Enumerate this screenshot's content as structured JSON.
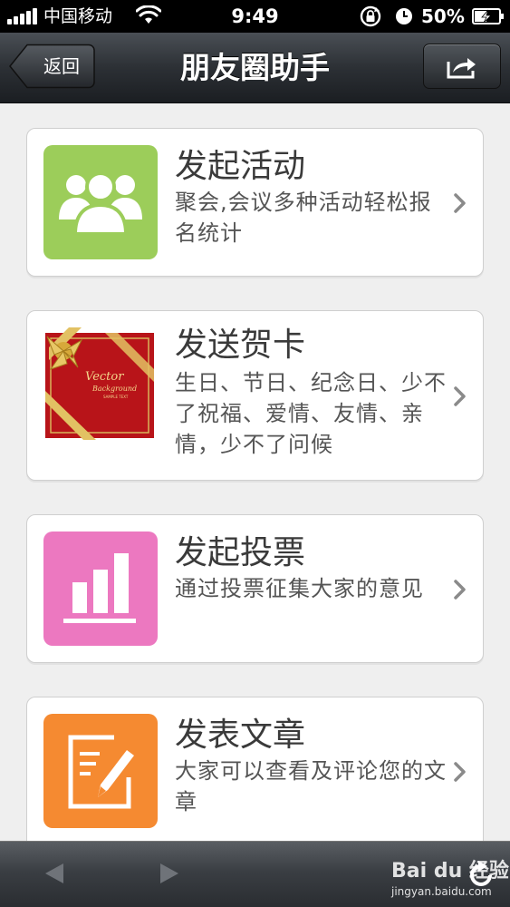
{
  "status_bar": {
    "carrier": "中国移动",
    "time": "9:49",
    "battery_percent": "50%",
    "icons": [
      "signal-icon",
      "wifi-icon",
      "rotation-lock-icon",
      "alarm-icon",
      "battery-charging-icon"
    ]
  },
  "nav": {
    "title": "朋友圈助手",
    "back_label": "返回",
    "share_icon": "share-icon"
  },
  "cards": [
    {
      "title": "发起活动",
      "desc": "聚会,会议多种活动轻松报名统计",
      "icon": "group-people-icon",
      "icon_color": "#9ccd5a"
    },
    {
      "title": "发送贺卡",
      "desc": "生日、节日、纪念日、少不了祝福、爱情、友情、亲情，少不了问候",
      "icon": "gift-card-icon",
      "icon_color": "#b81419"
    },
    {
      "title": "发起投票",
      "desc": "通过投票征集大家的意见",
      "icon": "bar-chart-icon",
      "icon_color": "#ec78c0"
    },
    {
      "title": "发表文章",
      "desc": "大家可以查看及评论您的文章",
      "icon": "edit-document-icon",
      "icon_color": "#f58a31"
    }
  ],
  "gift_card_text": {
    "line1": "Vector",
    "line2": "Background",
    "line3": "SAMPLE TEXT"
  },
  "toolbar": {
    "icons": [
      "back-arrow-icon",
      "forward-arrow-icon",
      "refresh-icon"
    ]
  },
  "watermark": {
    "logo": "Bai du 经验",
    "url": "jingyan.baidu.com"
  }
}
